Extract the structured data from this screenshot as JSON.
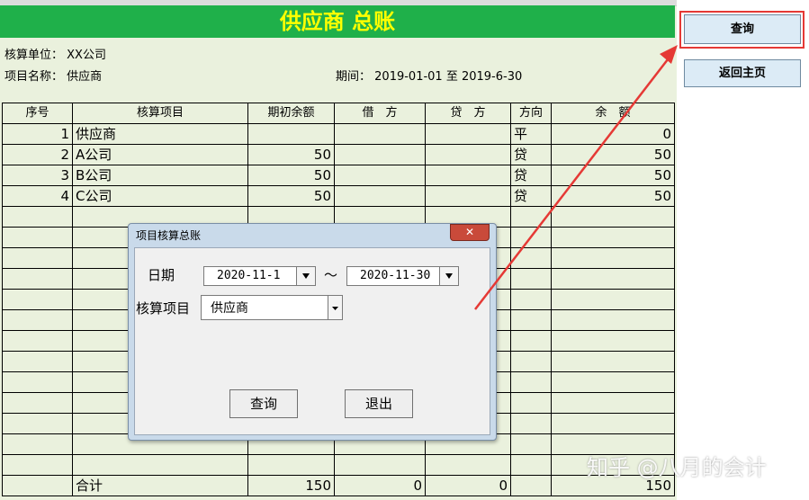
{
  "sheet": {
    "title": "供应商  总账",
    "unit_label": "核算单位：",
    "unit_value": "XX公司",
    "project_label": "项目名称：",
    "project_value": "供应商",
    "period_label": "期间：",
    "period_value": "2019-01-01 至 2019-6-30"
  },
  "table": {
    "headers": [
      "序号",
      "核算项目",
      "期初余额",
      "借　方",
      "贷　方",
      "方向",
      "余　额"
    ],
    "rows": [
      {
        "no": "1",
        "item": "供应商",
        "opening": "",
        "debit": "",
        "credit": "",
        "dir": "平",
        "balance": "0"
      },
      {
        "no": "2",
        "item": "A公司",
        "opening": "50",
        "debit": "",
        "credit": "",
        "dir": "贷",
        "balance": "50"
      },
      {
        "no": "3",
        "item": "B公司",
        "opening": "50",
        "debit": "",
        "credit": "",
        "dir": "贷",
        "balance": "50"
      },
      {
        "no": "4",
        "item": "C公司",
        "opening": "50",
        "debit": "",
        "credit": "",
        "dir": "贷",
        "balance": "50"
      }
    ],
    "total": {
      "label": "合计",
      "opening": "150",
      "debit": "0",
      "credit": "0",
      "balance": "150"
    }
  },
  "side_buttons": {
    "query": "查询",
    "home": "返回主页"
  },
  "dialog": {
    "title": "项目核算总账",
    "close_icon": "close-icon",
    "date_label": "日期",
    "date_from": "2020-11-1",
    "tilde": "～",
    "date_to": "2020-11-30",
    "item_label": "核算项目",
    "item_value": "供应商",
    "query_button": "查询",
    "exit_button": "退出"
  },
  "watermark": "知乎 @八月的会计",
  "colors": {
    "title_bg": "#1fb04a",
    "title_text": "#ffff00",
    "sheet_bg": "#eaf1dd",
    "annotation": "#e53935"
  }
}
